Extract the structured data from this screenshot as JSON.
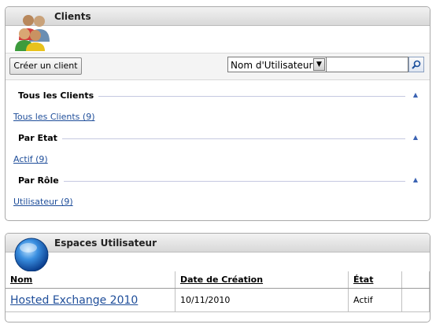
{
  "clients_panel": {
    "title": "Clients",
    "icon": "users-group-icon",
    "create_button": "Créer un client",
    "search": {
      "field_selected": "Nom d'Utilisateur",
      "query": ""
    },
    "sections": [
      {
        "title": "Tous les Clients",
        "link": "Tous les Clients (9)"
      },
      {
        "title": "Par Etat",
        "link": "Actif (9)"
      },
      {
        "title": "Par Rôle",
        "link": "Utilisateur (9)"
      }
    ]
  },
  "spaces_panel": {
    "title": "Espaces Utilisateur",
    "icon": "blue-orb-icon",
    "columns": [
      "Nom",
      "Date de Création",
      "État",
      ""
    ],
    "rows": [
      {
        "name": "Hosted Exchange 2010",
        "created": "10/11/2010",
        "state": "Actif"
      }
    ]
  },
  "colors": {
    "link": "#1f4e9a",
    "section_line": "#c5c8e0",
    "header_bg": "#d8d8d8"
  }
}
